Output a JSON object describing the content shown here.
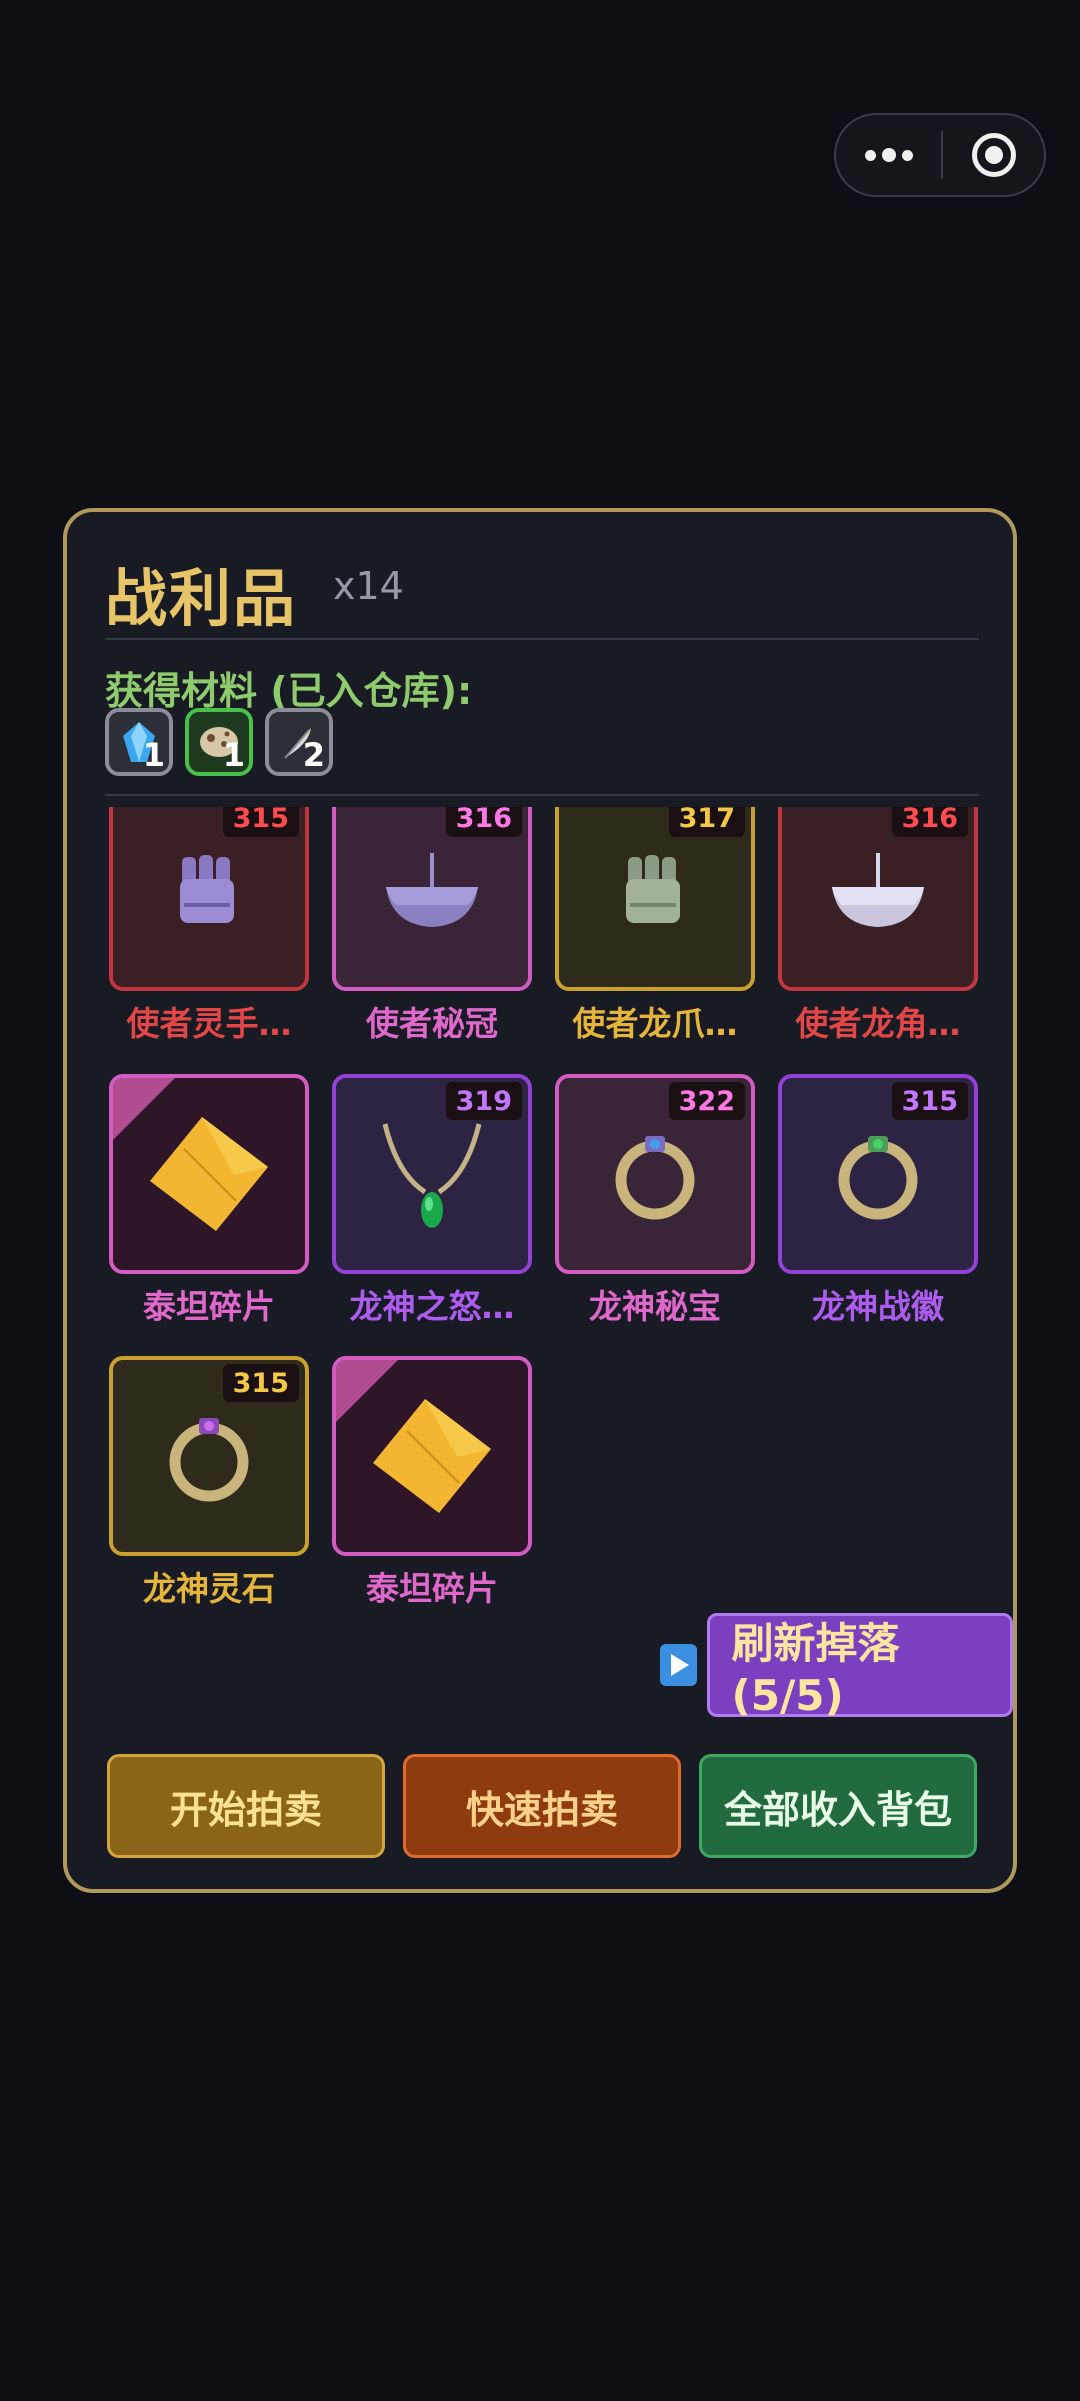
{
  "capsule": {
    "more_icon": "more-dots-icon",
    "close_icon": "target-circle-icon"
  },
  "panel": {
    "title": "战利品",
    "count": "x14",
    "materials_label": "获得材料 (已入仓库):",
    "materials": [
      {
        "icon": "blue-crystal-icon",
        "qty": "1"
      },
      {
        "icon": "egg-icon",
        "qty": "1"
      },
      {
        "icon": "feather-icon",
        "qty": "2"
      }
    ],
    "items": [
      {
        "name": "使者灵手…",
        "level": "315",
        "rarity": "red",
        "icon": "gauntlet-icon"
      },
      {
        "name": "使者秘冠",
        "level": "316",
        "rarity": "pink",
        "icon": "bowl-helmet-icon"
      },
      {
        "name": "使者龙爪…",
        "level": "317",
        "rarity": "gold",
        "icon": "gauntlet-icon"
      },
      {
        "name": "使者龙角…",
        "level": "316",
        "rarity": "red",
        "icon": "bowl-helmet-icon"
      },
      {
        "name": "泰坦碎片",
        "level": "",
        "rarity": "pink",
        "icon": "titan-shard-icon"
      },
      {
        "name": "龙神之怒…",
        "level": "319",
        "rarity": "purple",
        "icon": "necklace-icon"
      },
      {
        "name": "龙神秘宝",
        "level": "322",
        "rarity": "pink",
        "icon": "ring-icon"
      },
      {
        "name": "龙神战徽",
        "level": "315",
        "rarity": "purple",
        "icon": "ring-icon"
      },
      {
        "name": "龙神灵石",
        "level": "315",
        "rarity": "gold",
        "icon": "ring-icon"
      },
      {
        "name": "泰坦碎片",
        "level": "",
        "rarity": "pink",
        "icon": "titan-shard-icon"
      }
    ],
    "refresh_label": "刷新掉落 (5/5)",
    "buttons": {
      "auction": "开始拍卖",
      "quick_auction": "快速拍卖",
      "collect_all": "全部收入背包"
    }
  },
  "colors": {
    "panel_border": "#b0995a",
    "title": "#e7c468",
    "red": "#c2363f",
    "pink": "#d25cc1",
    "gold": "#c9a12c",
    "purple": "#9441d8"
  }
}
